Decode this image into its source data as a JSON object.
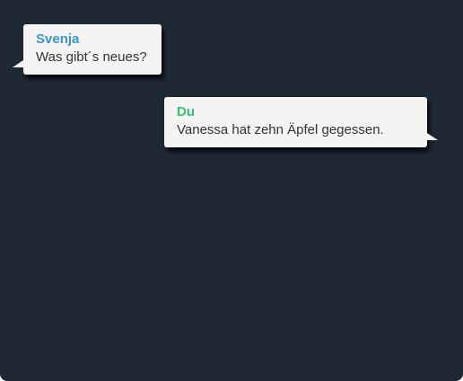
{
  "colors": {
    "panel_background": "#1e2935",
    "bubble_background": "#f4f4f4",
    "incoming_sender": "#3d95cf",
    "outgoing_sender": "#35c26b",
    "message_text": "#333333"
  },
  "messages": [
    {
      "direction": "incoming",
      "sender": "Svenja",
      "text": "Was gibt´s neues?"
    },
    {
      "direction": "outgoing",
      "sender": "Du",
      "text": "Vanessa hat zehn Äpfel gegessen."
    }
  ]
}
